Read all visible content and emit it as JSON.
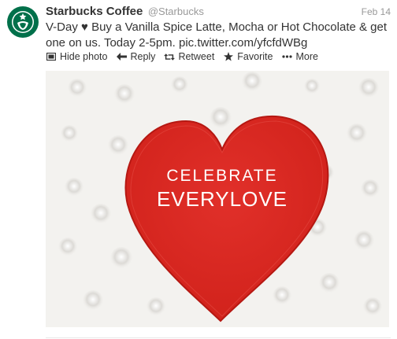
{
  "tweet": {
    "author_name": "Starbucks Coffee",
    "author_handle": "@Starbucks",
    "timestamp": "Feb 14",
    "text_line1": "V-Day ♥ Buy a Vanilla Spice Latte, Mocha or Hot Chocolate & get",
    "text_line2": "one on us. Today 2-5pm. pic.twitter.com/yfcfdWBg"
  },
  "actions": {
    "hide_photo": "Hide photo",
    "reply": "Reply",
    "retweet": "Retweet",
    "favorite": "Favorite",
    "more": "More"
  },
  "media": {
    "line1": "CELEBRATE",
    "line2": "EVERYLOVE"
  },
  "colors": {
    "heart_red": "#d7261e",
    "starbucks_green": "#00704a",
    "photo_bg": "#f3f2ef"
  }
}
